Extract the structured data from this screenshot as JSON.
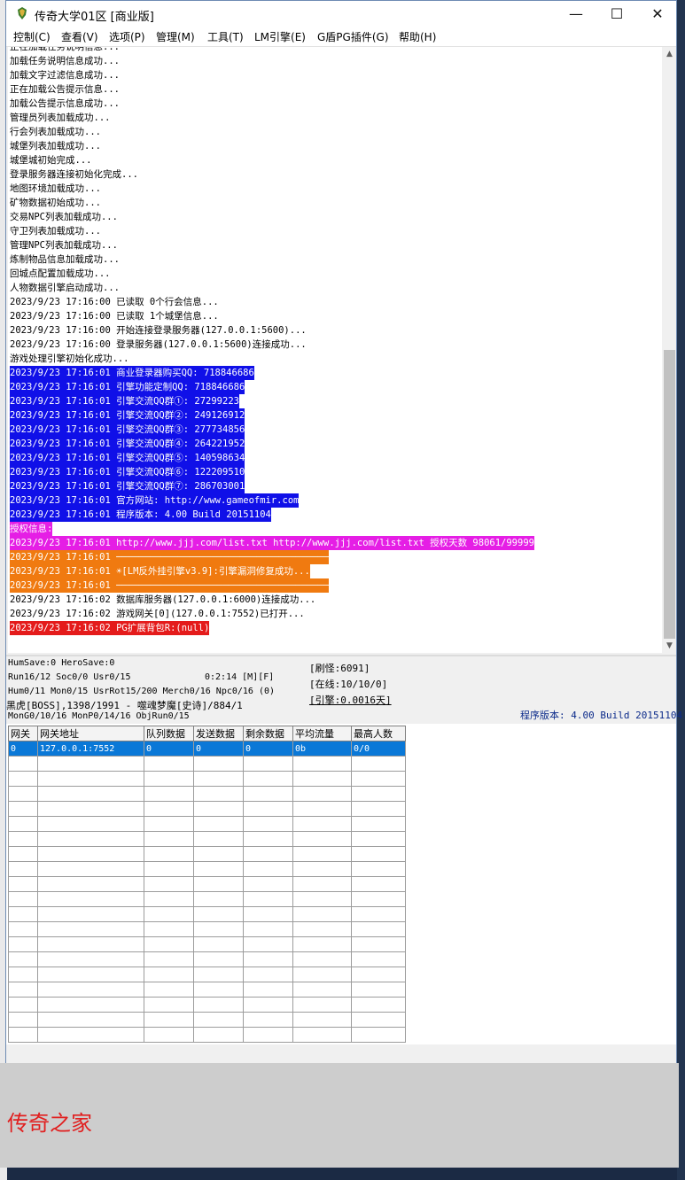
{
  "window": {
    "title": "传奇大学01区 [商业版]",
    "minimize_glyph": "—",
    "maximize_glyph": "☐",
    "close_glyph": "✕"
  },
  "menu": [
    "控制(C)",
    "查看(V)",
    "选项(P)",
    "管理(M)",
    "工具(T)",
    "LM引擎(E)",
    "G盾PG插件(G)",
    "帮助(H)"
  ],
  "log_lines": [
    {
      "text": "正在加载任务说明信息...",
      "bg": "",
      "fg": "#000000"
    },
    {
      "text": "加载任务说明信息成功...",
      "bg": "",
      "fg": "#000000"
    },
    {
      "text": "加载文字过滤信息成功...",
      "bg": "",
      "fg": "#000000"
    },
    {
      "text": "正在加载公告提示信息...",
      "bg": "",
      "fg": "#000000"
    },
    {
      "text": "加载公告提示信息成功...",
      "bg": "",
      "fg": "#000000"
    },
    {
      "text": "管理员列表加载成功...",
      "bg": "",
      "fg": "#000000"
    },
    {
      "text": "行会列表加载成功...",
      "bg": "",
      "fg": "#000000"
    },
    {
      "text": "城堡列表加载成功...",
      "bg": "",
      "fg": "#000000"
    },
    {
      "text": "城堡城初始完成...",
      "bg": "",
      "fg": "#000000"
    },
    {
      "text": "登录服务器连接初始化完成...",
      "bg": "",
      "fg": "#000000"
    },
    {
      "text": "地图环境加载成功...",
      "bg": "",
      "fg": "#000000"
    },
    {
      "text": "矿物数据初始成功...",
      "bg": "",
      "fg": "#000000"
    },
    {
      "text": "交易NPC列表加载成功...",
      "bg": "",
      "fg": "#000000"
    },
    {
      "text": "守卫列表加载成功...",
      "bg": "",
      "fg": "#000000"
    },
    {
      "text": "管理NPC列表加载成功...",
      "bg": "",
      "fg": "#000000"
    },
    {
      "text": "炼制物品信息加载成功...",
      "bg": "",
      "fg": "#000000"
    },
    {
      "text": "回城点配置加载成功...",
      "bg": "",
      "fg": "#000000"
    },
    {
      "text": "人物数据引擎启动成功...",
      "bg": "",
      "fg": "#000000"
    },
    {
      "text": "2023/9/23 17:16:00 已读取 0个行会信息...",
      "bg": "",
      "fg": "#000000"
    },
    {
      "text": "2023/9/23 17:16:00 已读取 1个城堡信息...",
      "bg": "",
      "fg": "#000000"
    },
    {
      "text": "2023/9/23 17:16:00 开始连接登录服务器(127.0.0.1:5600)...",
      "bg": "",
      "fg": "#000000"
    },
    {
      "text": "2023/9/23 17:16:00 登录服务器(127.0.0.1:5600)连接成功...",
      "bg": "",
      "fg": "#000000"
    },
    {
      "text": "游戏处理引擎初始化成功...",
      "bg": "",
      "fg": "#000000"
    },
    {
      "text": "2023/9/23 17:16:01 商业登录器购买QQ: 718846686",
      "bg": "#1010e8",
      "fg": "#ffffff"
    },
    {
      "text": "2023/9/23 17:16:01 引擎功能定制QQ: 718846686",
      "bg": "#1010e8",
      "fg": "#ffffff"
    },
    {
      "text": "2023/9/23 17:16:01 引擎交流QQ群①: 27299223",
      "bg": "#1010e8",
      "fg": "#ffffff"
    },
    {
      "text": "2023/9/23 17:16:01 引擎交流QQ群②: 249126912",
      "bg": "#1010e8",
      "fg": "#ffffff"
    },
    {
      "text": "2023/9/23 17:16:01 引擎交流QQ群③: 277734856",
      "bg": "#1010e8",
      "fg": "#ffffff"
    },
    {
      "text": "2023/9/23 17:16:01 引擎交流QQ群④: 264221952",
      "bg": "#1010e8",
      "fg": "#ffffff"
    },
    {
      "text": "2023/9/23 17:16:01 引擎交流QQ群⑤: 140598634",
      "bg": "#1010e8",
      "fg": "#ffffff"
    },
    {
      "text": "2023/9/23 17:16:01 引擎交流QQ群⑥: 122209510",
      "bg": "#1010e8",
      "fg": "#ffffff"
    },
    {
      "text": "2023/9/23 17:16:01 引擎交流QQ群⑦: 286703001",
      "bg": "#1010e8",
      "fg": "#ffffff"
    },
    {
      "text": "2023/9/23 17:16:01 官方网站: http://www.gameofmir.com",
      "bg": "#1010e8",
      "fg": "#ffffff"
    },
    {
      "text": "2023/9/23 17:16:01 程序版本: 4.00 Build 20151104",
      "bg": "#1010e8",
      "fg": "#ffffff"
    },
    {
      "text": "授权信息:",
      "bg": "#e51ee5",
      "fg": "#ffffff"
    },
    {
      "text": "2023/9/23 17:16:01 http://www.jjj.com/list.txt http://www.jjj.com/list.txt 授权天数 98061/99999",
      "bg": "#e51ee5",
      "fg": "#ffffff"
    },
    {
      "text": "2023/9/23 17:16:01 ──────────────────────────────────────",
      "bg": "#f07a10",
      "fg": "#ffffff"
    },
    {
      "text": "2023/9/23 17:16:01 ☀[LM反外挂引擎v3.9]:引擎漏洞修复成功...",
      "bg": "#f07a10",
      "fg": "#ffffff"
    },
    {
      "text": "2023/9/23 17:16:01 ──────────────────────────────────────",
      "bg": "#f07a10",
      "fg": "#ffffff"
    },
    {
      "text": "2023/9/23 17:16:02 数据库服务器(127.0.0.1:6000)连接成功...",
      "bg": "",
      "fg": "#000000"
    },
    {
      "text": "2023/9/23 17:16:02 游戏网关[0](127.0.0.1:7552)已打开...",
      "bg": "",
      "fg": "#000000"
    },
    {
      "text": "2023/9/23 17:16:02 PG扩展背包R:(null)",
      "bg": "#e41b1b",
      "fg": "#ffffff"
    }
  ],
  "status": {
    "line1": "HumSave:0 HeroSave:0",
    "line2a": "Run16/12 Soc0/0 Usr0/15",
    "line2b": "0:2:14 [M][F]",
    "line3": "Hum0/11 Mon0/15 UsrRot15/200 Merch0/16 Npc0/16 (0)",
    "line4": "黑虎[BOSS],1398/1991 - 噬魂梦魔[史诗]/884/1",
    "line5": "MonG0/10/16 MonP0/14/16 ObjRun0/15",
    "refresh": "[刷怪:6091]",
    "online": "[在线:10/10/0]",
    "engine": "[引擎:0.0016天]",
    "version": "程序版本: 4.00 Build 20151104"
  },
  "gateway_table": {
    "headers": [
      "网关",
      "网关地址",
      "队列数据",
      "发送数据",
      "剩余数据",
      "平均流量",
      "最高人数"
    ],
    "rows": [
      [
        "0",
        "127.0.0.1:7552",
        "0",
        "0",
        "0",
        "0b",
        "0/0"
      ]
    ],
    "empty_rows": 19
  },
  "watermark": "传奇之家"
}
